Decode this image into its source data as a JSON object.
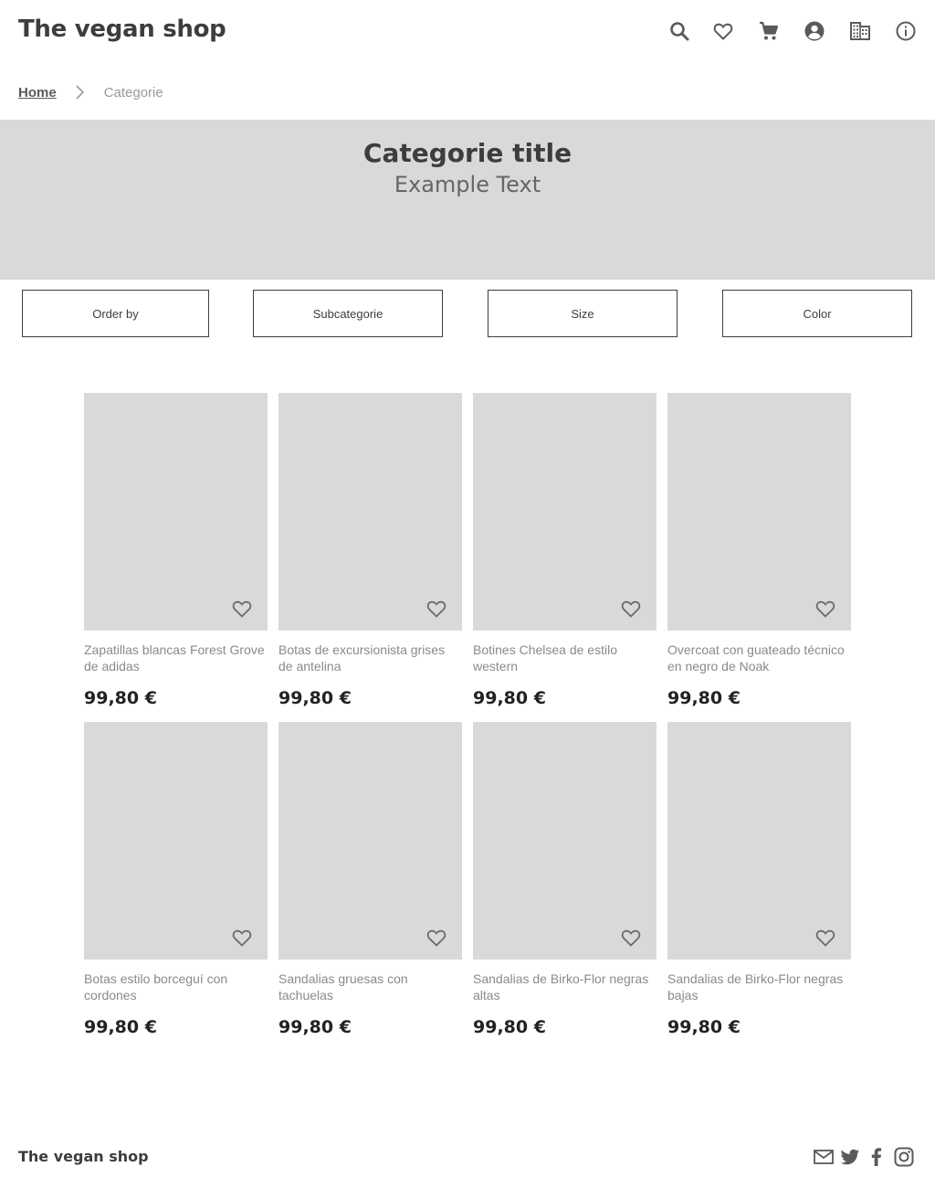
{
  "header": {
    "brand": "The vegan shop",
    "icons": [
      "search-icon",
      "heart-icon",
      "cart-icon",
      "account-icon",
      "store-icon",
      "info-icon"
    ]
  },
  "breadcrumb": {
    "home": "Home",
    "current": "Categorie"
  },
  "banner": {
    "title": "Categorie title",
    "subtitle": "Example Text"
  },
  "filters": {
    "order_by": "Order by",
    "subcategorie": "Subcategorie",
    "size": "Size",
    "color": "Color"
  },
  "products": [
    {
      "name": "Zapatillas blancas Forest Grove de adidas",
      "price": "99,80 €"
    },
    {
      "name": "Botas de excursionista grises de antelina",
      "price": "99,80 €"
    },
    {
      "name": "Botines Chelsea de estilo western",
      "price": "99,80 €"
    },
    {
      "name": "Overcoat con guateado técnico en negro de Noak",
      "price": "99,80 €"
    },
    {
      "name": "Botas estilo borceguí con cordones",
      "price": "99,80 €"
    },
    {
      "name": "Sandalias gruesas con tachuelas",
      "price": "99,80 €"
    },
    {
      "name": "Sandalias de Birko-Flor negras altas",
      "price": "99,80 €"
    },
    {
      "name": "Sandalias de Birko-Flor negras bajas",
      "price": "99,80 €"
    }
  ],
  "footer": {
    "brand": "The vegan shop",
    "social": [
      "mail-icon",
      "twitter-icon",
      "facebook-icon",
      "instagram-icon"
    ]
  },
  "colors": {
    "text": "#3d3d3d",
    "placeholder": "#d9d9d9",
    "muted": "#8a8a8a"
  }
}
